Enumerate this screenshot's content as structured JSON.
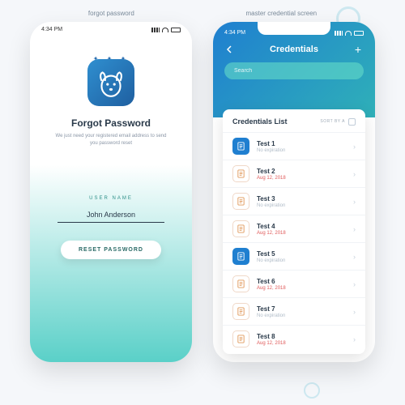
{
  "labels": {
    "left": "forgot password",
    "right": "master credential screen"
  },
  "status": {
    "time": "4:34 PM"
  },
  "forgot": {
    "title": "Forgot Password",
    "subtitle": "We just need your registered email address to send you password reset",
    "field_label": "USER NAME",
    "username": "John Anderson",
    "button": "RESET PASSWORD"
  },
  "creds": {
    "title": "Credentials",
    "search_placeholder": "Search",
    "list_title": "Credentials List",
    "sort_label": "SORT BY A",
    "items": [
      {
        "title": "Test 1",
        "sub": "No expiration",
        "red": false,
        "blue": true
      },
      {
        "title": "Test 2",
        "sub": "Aug 12, 2018",
        "red": true,
        "blue": false
      },
      {
        "title": "Test 3",
        "sub": "No expiration",
        "red": false,
        "blue": false
      },
      {
        "title": "Test 4",
        "sub": "Aug 12, 2018",
        "red": true,
        "blue": false
      },
      {
        "title": "Test 5",
        "sub": "No expiration",
        "red": false,
        "blue": true
      },
      {
        "title": "Test 6",
        "sub": "Aug 12, 2018",
        "red": true,
        "blue": false
      },
      {
        "title": "Test 7",
        "sub": "No expiration",
        "red": false,
        "blue": false
      },
      {
        "title": "Test 8",
        "sub": "Aug 12, 2018",
        "red": true,
        "blue": false
      }
    ]
  }
}
